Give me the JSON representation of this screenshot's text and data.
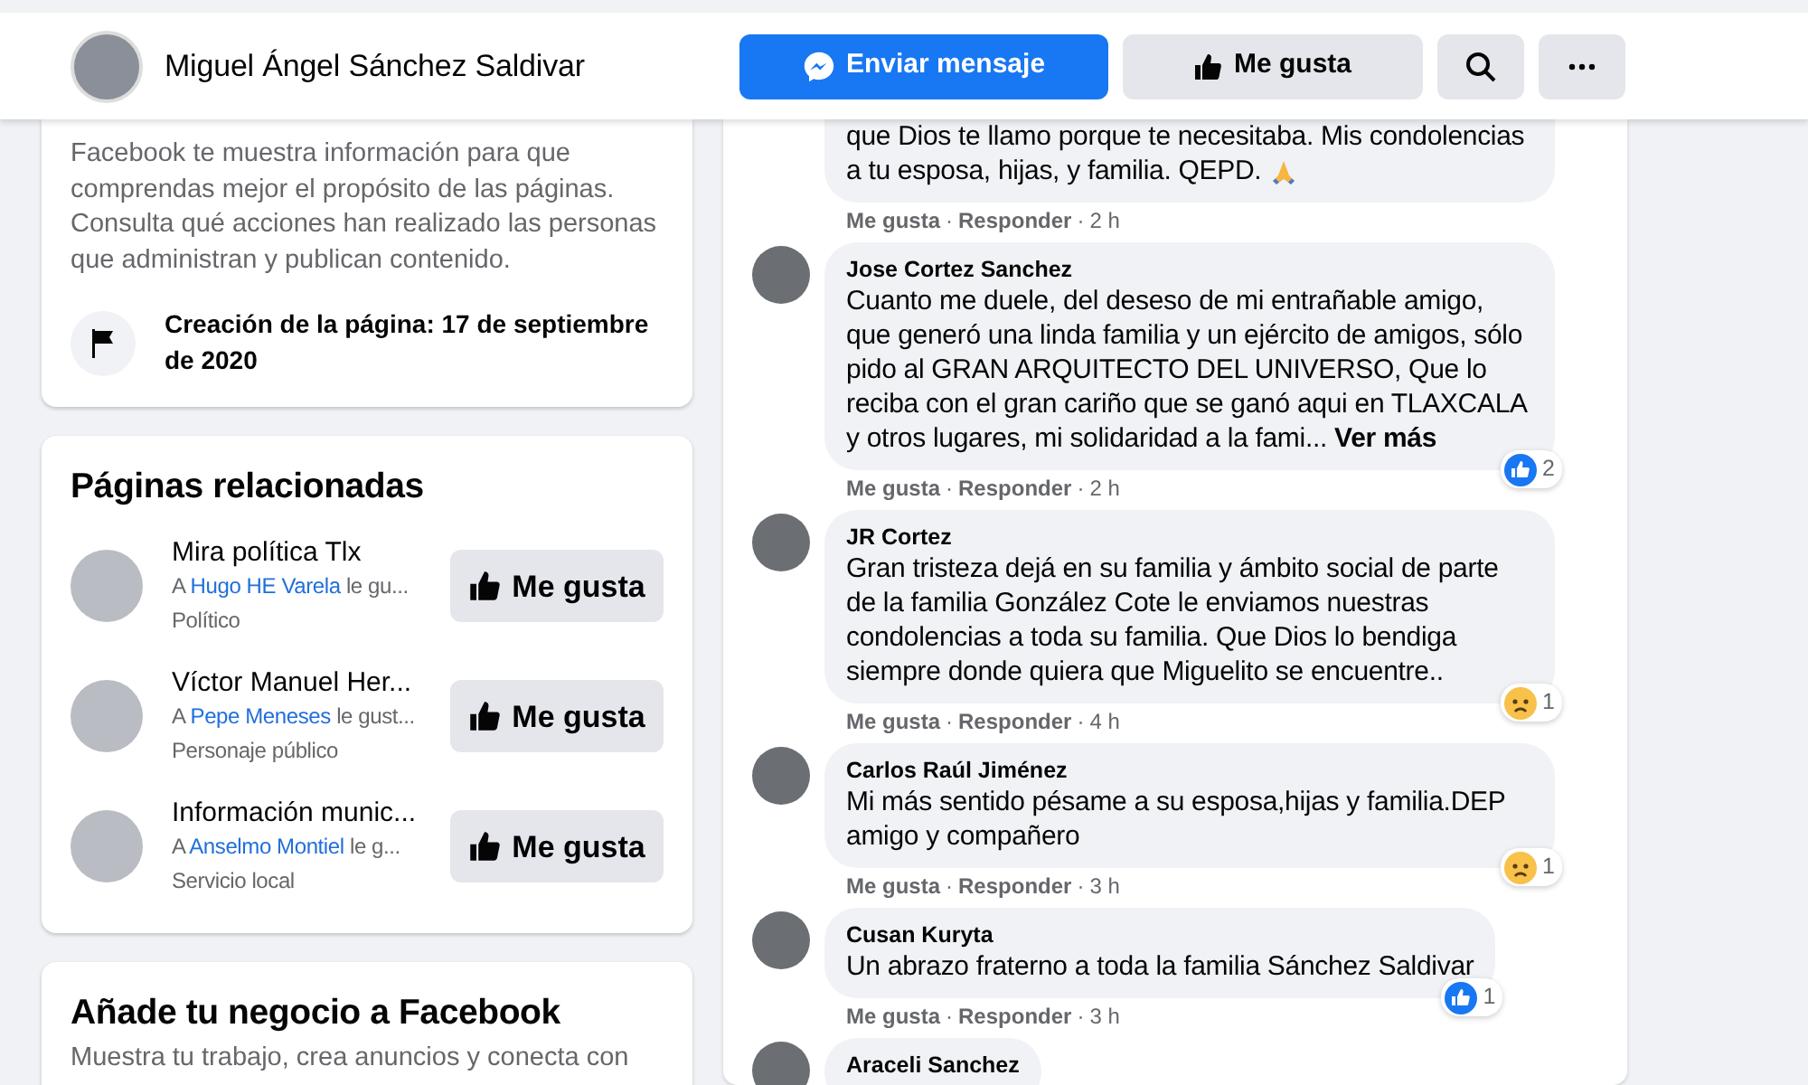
{
  "header": {
    "page_name": "Miguel Ángel Sánchez Saldivar",
    "buttons": [
      {
        "kind": "message",
        "label": "Enviar mensaje"
      },
      {
        "kind": "like",
        "label": "Me gusta"
      },
      {
        "kind": "search"
      },
      {
        "kind": "more"
      }
    ]
  },
  "transparency": {
    "description": "Facebook te muestra información para que comprendas mejor el propósito de las páginas. Consulta qué acciones han realizado las personas que administran y publican contenido.",
    "creation": "Creación de la página: 17 de septiembre de 2020"
  },
  "related_pages": {
    "title": "Páginas relacionadas",
    "items": [
      {
        "name": "Mira política Tlx",
        "liked_prefix": "A ",
        "liked_by": "Hugo HE Varela",
        "liked_suffix": " le gu...",
        "category": "Político",
        "button": "Me gusta"
      },
      {
        "name": "Víctor Manuel Her...",
        "liked_prefix": "A ",
        "liked_by": "Pepe Meneses",
        "liked_suffix": " le gust...",
        "category": "Personaje público",
        "button": "Me gusta"
      },
      {
        "name": "Información munic...",
        "liked_prefix": "A ",
        "liked_by": "Anselmo Montiel",
        "liked_suffix": " le g...",
        "category": "Servicio local",
        "button": "Me gusta"
      }
    ]
  },
  "business": {
    "title": "Añade tu negocio a Facebook",
    "text": "Muestra tu trabajo, crea anuncios y conecta con"
  },
  "comments": [
    {
      "cut_top": true,
      "text": "que Dios te llamo porque te necesitaba. Mis condolencias a tu esposa, hijas, y familia. QEPD.",
      "has_emoji": true,
      "meta": {
        "like": "Me gusta",
        "sep1": "·",
        "reply": "Responder",
        "sep2": "·",
        "time": "2 h"
      }
    },
    {
      "author": "Jose Cortez Sanchez",
      "text": "Cuanto me duele, del deseso de mi entrañable amigo, que generó una linda familia y un ejército de amigos, sólo pido al GRAN ARQUITECTO DEL UNIVERSO, Que lo reciba con el gran cariño que se ganó aqui en TLAXCALA y otros lugares, mi solidaridad a la fami...",
      "more": "Ver más",
      "reaction": {
        "kind": "like",
        "count": "2"
      },
      "meta": {
        "like": "Me gusta",
        "sep1": "·",
        "reply": "Responder",
        "sep2": "·",
        "time": "2 h"
      }
    },
    {
      "author": "JR Cortez",
      "text": "Gran tristeza dejá en su familia y ámbito social de parte de la familia González Cote le enviamos nuestras condolencias a toda su familia. Que Dios lo bendiga siempre donde quiera que Miguelito se encuentre..",
      "reaction": {
        "kind": "sad",
        "count": "1"
      },
      "meta": {
        "like": "Me gusta",
        "sep1": "·",
        "reply": "Responder",
        "sep2": "·",
        "time": "4 h"
      }
    },
    {
      "author": "Carlos Raúl Jiménez",
      "text": "Mi más sentido pésame a su esposa,hijas y familia.DEP amigo y compañero",
      "reaction": {
        "kind": "sad",
        "count": "1"
      },
      "meta": {
        "like": "Me gusta",
        "sep1": "·",
        "reply": "Responder",
        "sep2": "·",
        "time": "3 h"
      }
    },
    {
      "author": "Cusan Kuryta",
      "text": "Un abrazo fraterno a toda la familia Sánchez Saldivar",
      "reaction": {
        "kind": "like",
        "count": "1"
      },
      "meta": {
        "like": "Me gusta",
        "sep1": "·",
        "reply": "Responder",
        "sep2": "·",
        "time": "3 h"
      }
    },
    {
      "author": "Araceli Sanchez"
    }
  ]
}
